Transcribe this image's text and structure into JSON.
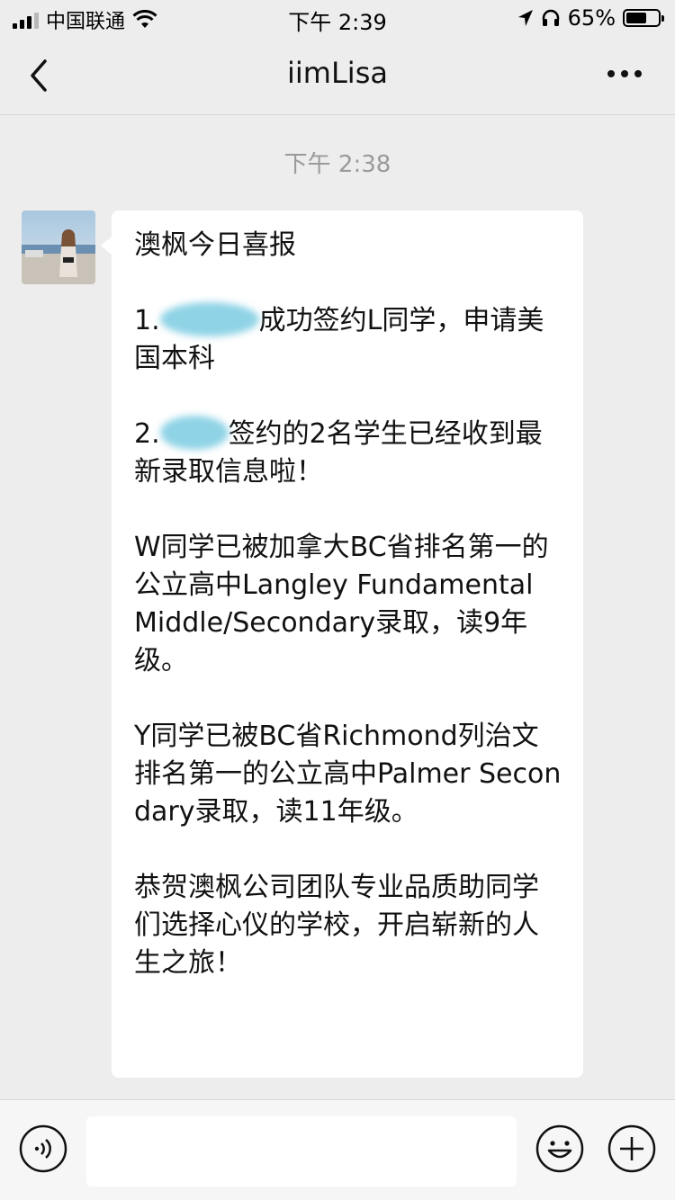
{
  "status_bar": {
    "carrier": "中国联通",
    "time": "下午 2:39",
    "battery_percent": "65%",
    "battery_level": 0.65
  },
  "nav": {
    "title": "iimLisa",
    "back_icon": "chevron-left-icon",
    "more_icon": "more-horizontal-icon"
  },
  "chat": {
    "timestamp": "下午 2:38",
    "message": {
      "title": "澳枫今日喜报",
      "item1_prefix": "1.",
      "item1_text": "成功签约L同学，申请美国本科",
      "item2_prefix": "2.",
      "item2_text": "签约的2名学生已经收到最新录取信息啦！",
      "para_w": "W同学已被加拿大BC省排名第一的公立高中Langley Fundamental Middle/Secondary录取，读9年级。",
      "para_y": "Y同学已被BC省Richmond列治文排名第一的公立高中Palmer Secondary录取，读11年级。",
      "para_congrats": "恭贺澳枫公司团队专业品质助同学们选择心仪的学校，开启崭新的人生之旅！"
    }
  },
  "input_bar": {
    "voice_icon": "voice-icon",
    "emoji_icon": "emoji-icon",
    "plus_icon": "plus-icon",
    "text_value": ""
  }
}
